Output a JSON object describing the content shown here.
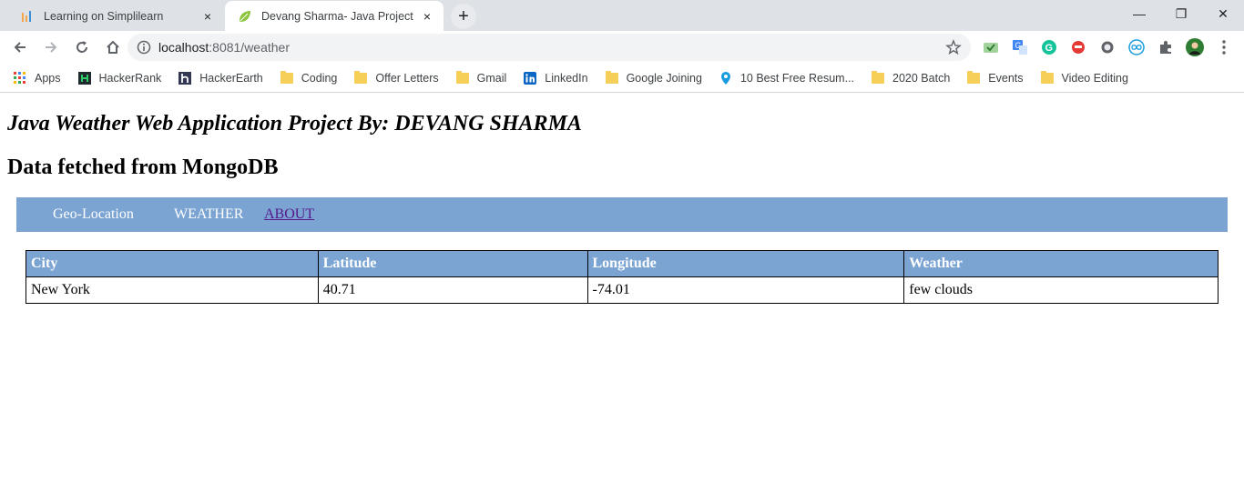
{
  "browser": {
    "tabs": [
      {
        "title": "Learning on Simplilearn",
        "active": false,
        "icon": "simplilearn-icon"
      },
      {
        "title": "Devang Sharma- Java Project",
        "active": true,
        "icon": "spring-leaf-icon"
      }
    ],
    "close_glyph": "×",
    "newtab_glyph": "+",
    "window_controls": {
      "minimize": "—",
      "restore": "❐",
      "close": "✕"
    },
    "url_host": "localhost",
    "url_rest": ":8081/weather",
    "bookmarks": [
      {
        "label": "Apps",
        "icon": "apps-grid-icon"
      },
      {
        "label": "HackerRank",
        "icon": "hackerrank-icon"
      },
      {
        "label": "HackerEarth",
        "icon": "hackerearth-icon"
      },
      {
        "label": "Coding",
        "icon": "folder-icon"
      },
      {
        "label": "Offer Letters",
        "icon": "folder-icon"
      },
      {
        "label": "Gmail",
        "icon": "folder-icon"
      },
      {
        "label": "LinkedIn",
        "icon": "linkedin-icon"
      },
      {
        "label": "Google Joining",
        "icon": "folder-icon"
      },
      {
        "label": "10 Best Free Resum...",
        "icon": "location-pin-icon"
      },
      {
        "label": "2020 Batch",
        "icon": "folder-icon"
      },
      {
        "label": "Events",
        "icon": "folder-icon"
      },
      {
        "label": "Video Editing",
        "icon": "folder-icon"
      }
    ]
  },
  "page": {
    "title": "Java Weather Web Application Project By: DEVANG SHARMA",
    "subtitle": "Data fetched from MongoDB",
    "nav": {
      "geo": "Geo-Location",
      "weather": "WEATHER",
      "about": "ABOUT"
    },
    "table": {
      "headers": [
        "City",
        "Latitude",
        "Longitude",
        "Weather"
      ],
      "rows": [
        [
          "New York",
          "40.71",
          "-74.01",
          "few clouds"
        ]
      ]
    },
    "colors": {
      "nav_bg": "#7ba4d3",
      "link_visited": "#551a8b"
    }
  }
}
